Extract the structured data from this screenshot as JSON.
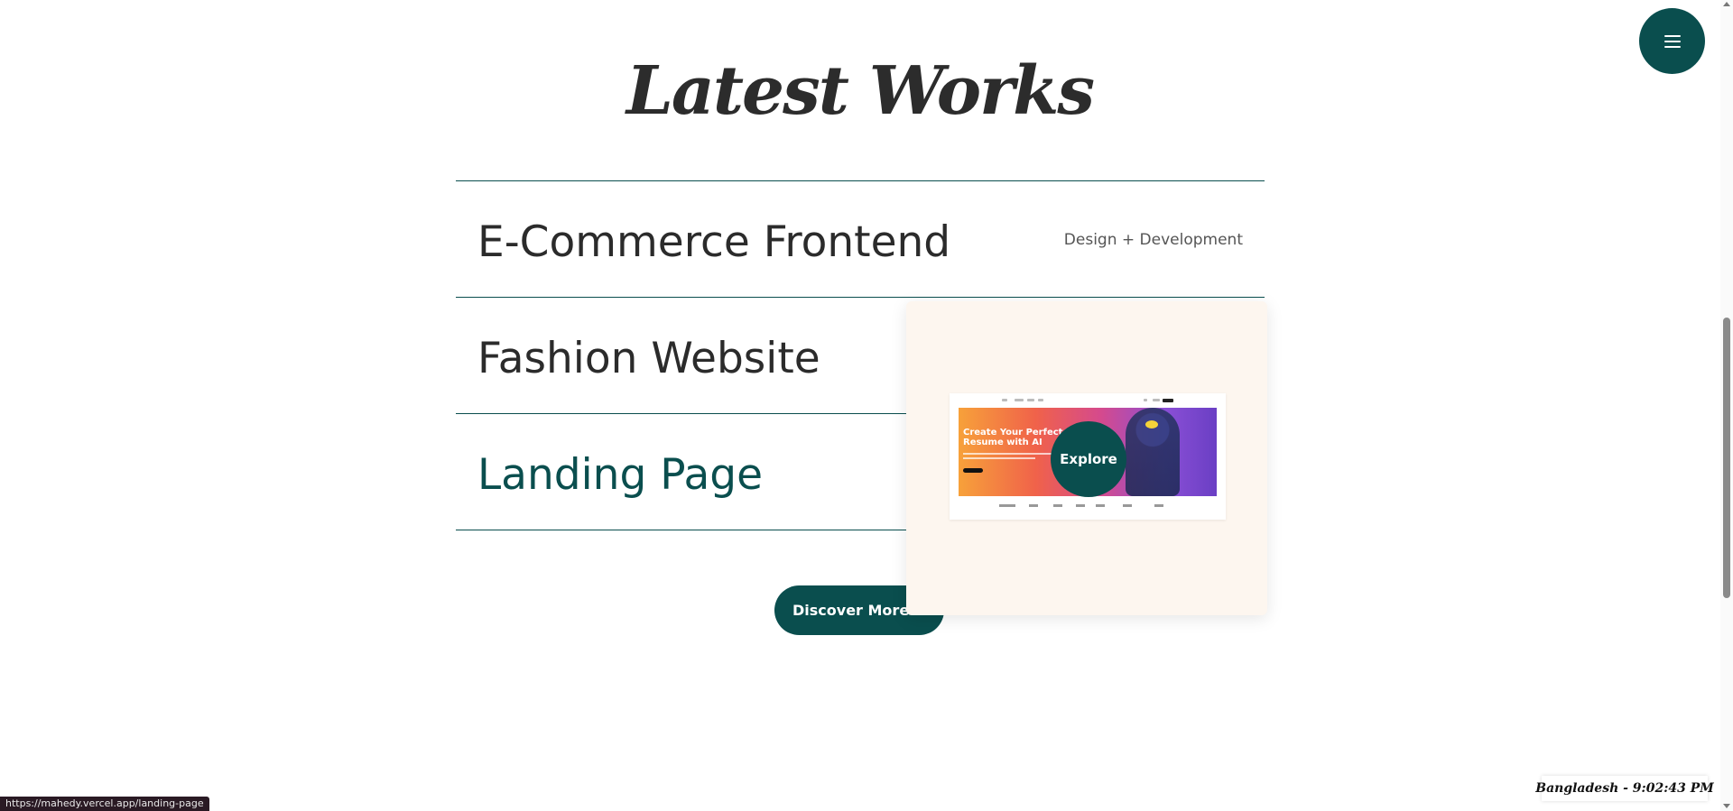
{
  "section": {
    "title": "Latest Works"
  },
  "works": [
    {
      "title": "E-Commerce Frontend",
      "tag": "Design + Development"
    },
    {
      "title": "Fashion Website",
      "tag": ""
    },
    {
      "title": "Landing Page",
      "tag": ""
    }
  ],
  "preview": {
    "headline": "Create Your Perfect Resume with AI",
    "explore_label": "Explore"
  },
  "discover": {
    "label": "Discover More Works"
  },
  "menu": {
    "icon": "hamburger-icon"
  },
  "status_bar": {
    "url": "https://mahedy.vercel.app/landing-page"
  },
  "clock": {
    "text": "Bangladesh - 9:02:43 PM"
  },
  "colors": {
    "accent": "#0a4e4e",
    "card_bg": "#fdf6ef"
  }
}
